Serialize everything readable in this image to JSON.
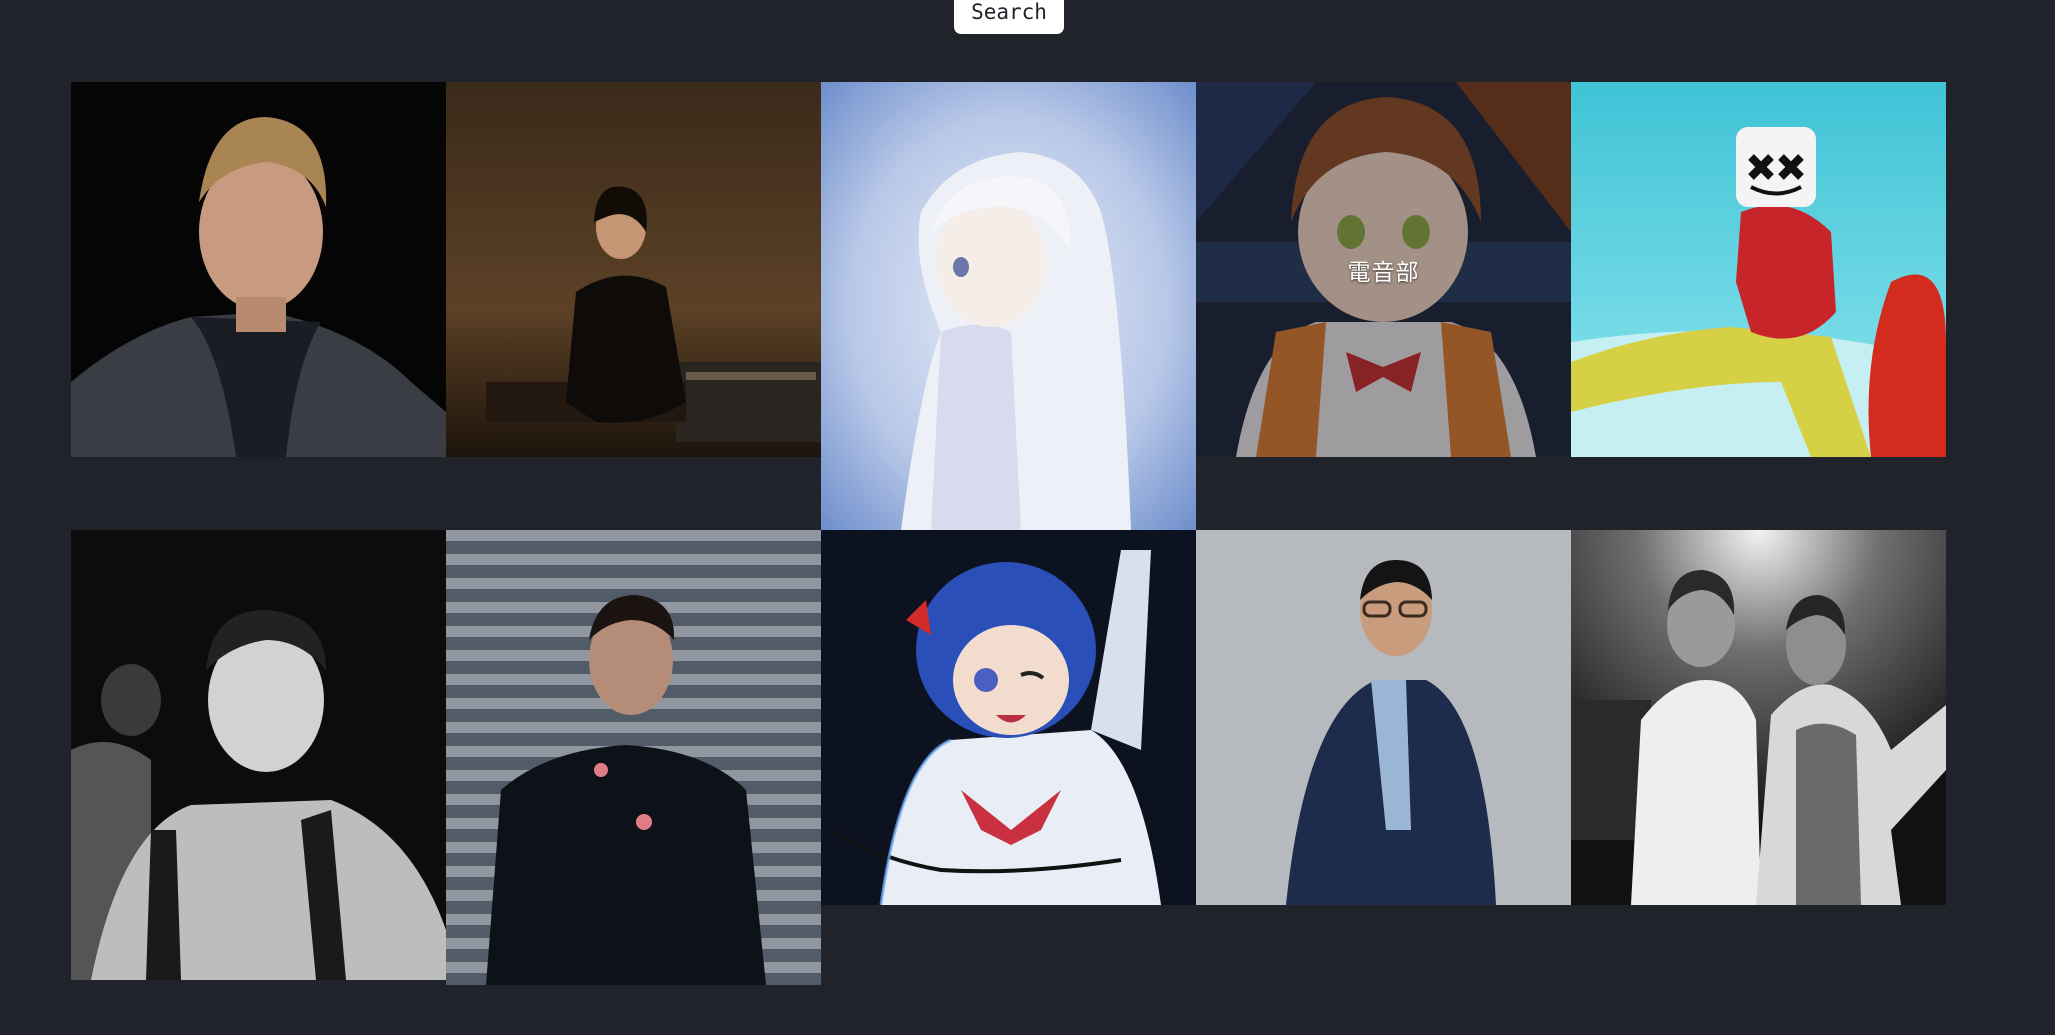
{
  "search": {
    "button_label": "Search"
  },
  "colors": {
    "background": "#202329",
    "button_bg": "#ffffff",
    "button_text": "#1f2228"
  },
  "gallery": {
    "tiles": [
      {
        "name": "artist-tile-1",
        "icon": "portrait-photo"
      },
      {
        "name": "artist-tile-2",
        "icon": "portrait-photo"
      },
      {
        "name": "artist-tile-3",
        "icon": "anime-illustration"
      },
      {
        "name": "artist-tile-4",
        "icon": "anime-illustration",
        "caption": "電音部"
      },
      {
        "name": "artist-tile-5",
        "icon": "portrait-photo"
      },
      {
        "name": "artist-tile-6",
        "icon": "portrait-photo"
      },
      {
        "name": "artist-tile-7",
        "icon": "portrait-photo"
      },
      {
        "name": "artist-tile-8",
        "icon": "anime-illustration"
      },
      {
        "name": "artist-tile-9",
        "icon": "portrait-photo"
      },
      {
        "name": "artist-tile-10",
        "icon": "portrait-photo"
      }
    ]
  }
}
